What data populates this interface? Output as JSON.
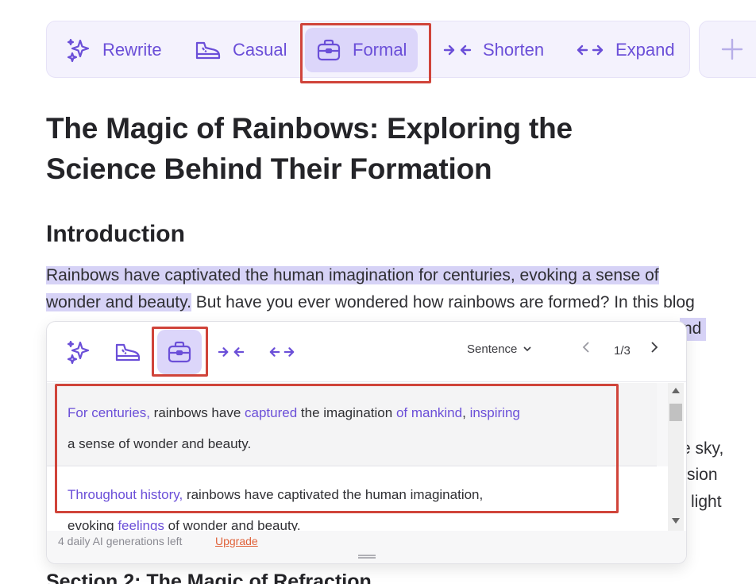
{
  "toolbar": {
    "items": [
      {
        "label": "Rewrite",
        "icon": "sparkles-icon"
      },
      {
        "label": "Casual",
        "icon": "sneaker-icon"
      },
      {
        "label": "Formal",
        "icon": "briefcase-icon",
        "active": true
      },
      {
        "label": "Shorten",
        "icon": "arrows-in-icon"
      },
      {
        "label": "Expand",
        "icon": "arrows-out-icon"
      }
    ],
    "add_icon": "plus-icon"
  },
  "article": {
    "title_line1": "The Magic of Rainbows: Exploring the",
    "title_line2": "Science Behind Their Formation",
    "intro_heading": "Introduction",
    "para_line1": "Rainbows have captivated the human imagination for centuries, evoking a sense of",
    "para_line2_hl": "wonder and beauty.",
    "para_line2_rest": " But have you ever wondered how rainbows are formed? In this blog",
    "peek_nd": "nd",
    "peek_sky": "e sky,",
    "peek_rsion": "rsion",
    "peek_light": "light",
    "section2_heading": "Section 2: The Magic of Refraction"
  },
  "popup": {
    "mode": "Sentence",
    "counter": "1/3",
    "suggestion1": {
      "line1": [
        {
          "t": "For centuries,",
          "changed": true
        },
        {
          "t": " rainbows have ",
          "changed": false
        },
        {
          "t": "captured",
          "changed": true
        },
        {
          "t": " the imagination ",
          "changed": false
        },
        {
          "t": "of mankind",
          "changed": true
        },
        {
          "t": ", ",
          "changed": false
        },
        {
          "t": "inspiring",
          "changed": true
        }
      ],
      "line2": "a sense of wonder and beauty."
    },
    "suggestion2": {
      "line1_changed": "Throughout history,",
      "line1_rest": " rainbows have captivated the human imagination,",
      "line2_a": "evoking ",
      "line2_changed": "feelings",
      "line2_b": " of wonder and beauty."
    },
    "footer_left": "4 daily AI generations left",
    "upgrade": "Upgrade"
  },
  "colors": {
    "accent": "#6b4fd8",
    "active_bg": "#dcd6fa",
    "highlight": "#d6d2f6",
    "callout": "#d0443a",
    "upgrade": "#e0623a"
  }
}
